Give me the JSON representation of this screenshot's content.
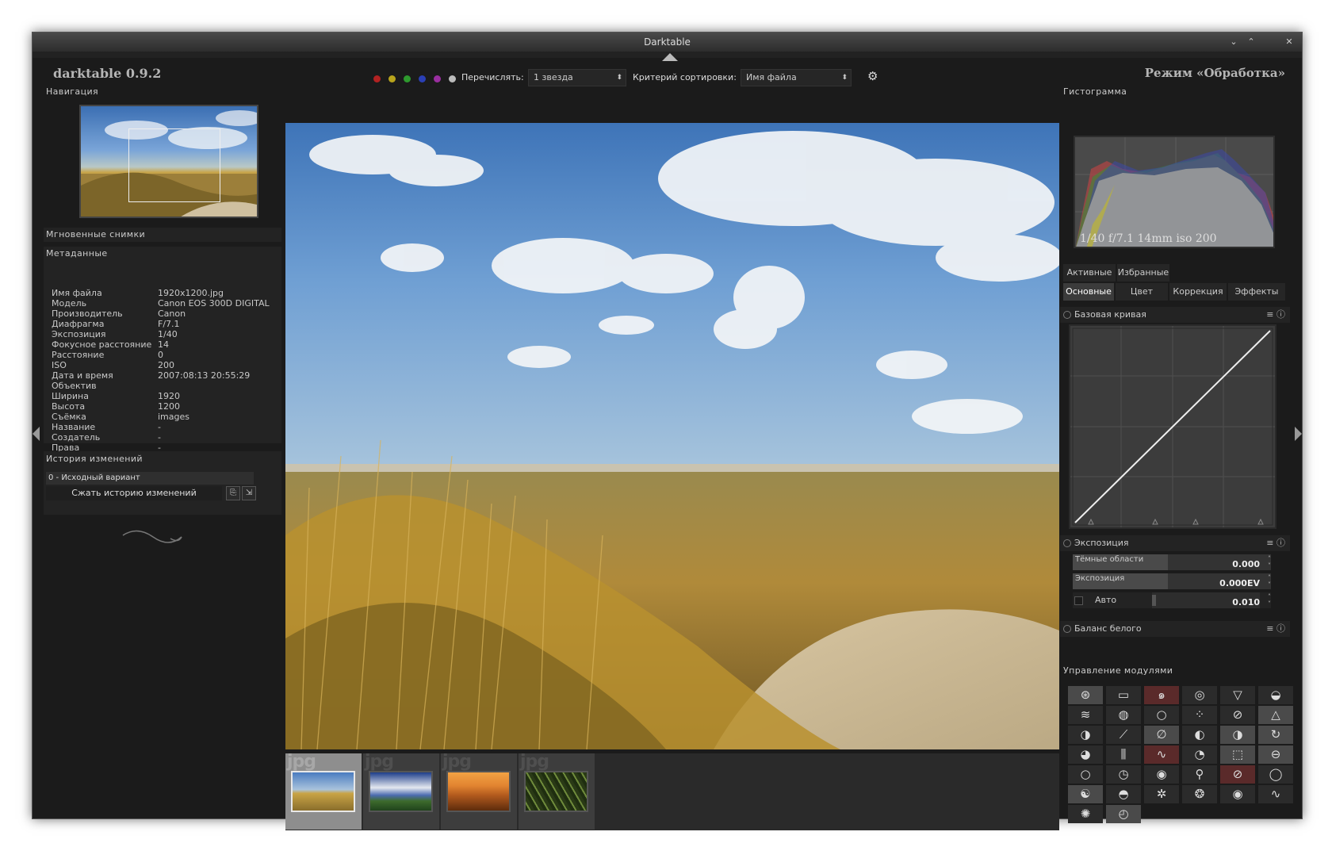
{
  "window": {
    "title": "Darktable"
  },
  "left": {
    "app_name": "darktable 0.9.2",
    "navigation_title": "Навигация",
    "snapshots_title": "Мгновенные снимки",
    "metadata_title": "Метаданные",
    "metadata": [
      {
        "k": "Имя файла",
        "v": "1920x1200.jpg"
      },
      {
        "k": "Модель",
        "v": "Canon EOS 300D DIGITAL"
      },
      {
        "k": "Производитель",
        "v": "Canon"
      },
      {
        "k": "Диафрагма",
        "v": "F/7.1"
      },
      {
        "k": "Экспозиция",
        "v": "1/40"
      },
      {
        "k": "Фокусное расстояние",
        "v": "14"
      },
      {
        "k": "Расстояние",
        "v": "0"
      },
      {
        "k": "ISO",
        "v": "200"
      },
      {
        "k": "Дата и время",
        "v": "2007:08:13 20:55:29"
      },
      {
        "k": "Объектив",
        "v": ""
      },
      {
        "k": "Ширина",
        "v": "1920"
      },
      {
        "k": "Высота",
        "v": "1200"
      },
      {
        "k": "Съёмка",
        "v": "images"
      },
      {
        "k": "Название",
        "v": "-"
      },
      {
        "k": "Создатель",
        "v": "-"
      },
      {
        "k": "Права",
        "v": "-"
      }
    ],
    "history_title": "История изменений",
    "history_item": "0 - Исходный вариант",
    "compress_label": "Сжать историю изменений"
  },
  "center": {
    "filter_label": "Перечислять:",
    "filter_value": "1 звезда",
    "sort_label": "Критерий сортировки:",
    "sort_value": "Имя файла",
    "color_labels": [
      "#b22222",
      "#b8a41c",
      "#2e9a2e",
      "#2a3fb5",
      "#9a2ea0",
      "#bbbbbb"
    ],
    "thumbnails": [
      {
        "ext": "jpg"
      },
      {
        "ext": "jpg"
      },
      {
        "ext": "jpg"
      },
      {
        "ext": "jpg"
      }
    ]
  },
  "right": {
    "mode_label": "Режим «Обработка»",
    "histogram_title": "Гистограмма",
    "histogram_info": "1/40 f/7.1 14mm iso 200",
    "group_tabs": [
      "Активные",
      "Избранные"
    ],
    "module_tabs": [
      "Основные",
      "Цвет",
      "Коррекция",
      "Эффекты"
    ],
    "base_curve": "Базовая кривая",
    "exposure_module": "Экспозиция",
    "dark_areas": {
      "label": "Тёмные области",
      "value": "0.000"
    },
    "exposure": {
      "label": "Экспозиция",
      "value": "0.000EV"
    },
    "auto": {
      "label": "Авто",
      "value": "0.010"
    },
    "white_balance": "Баланс белого",
    "modules_title": "Управление модулями"
  }
}
